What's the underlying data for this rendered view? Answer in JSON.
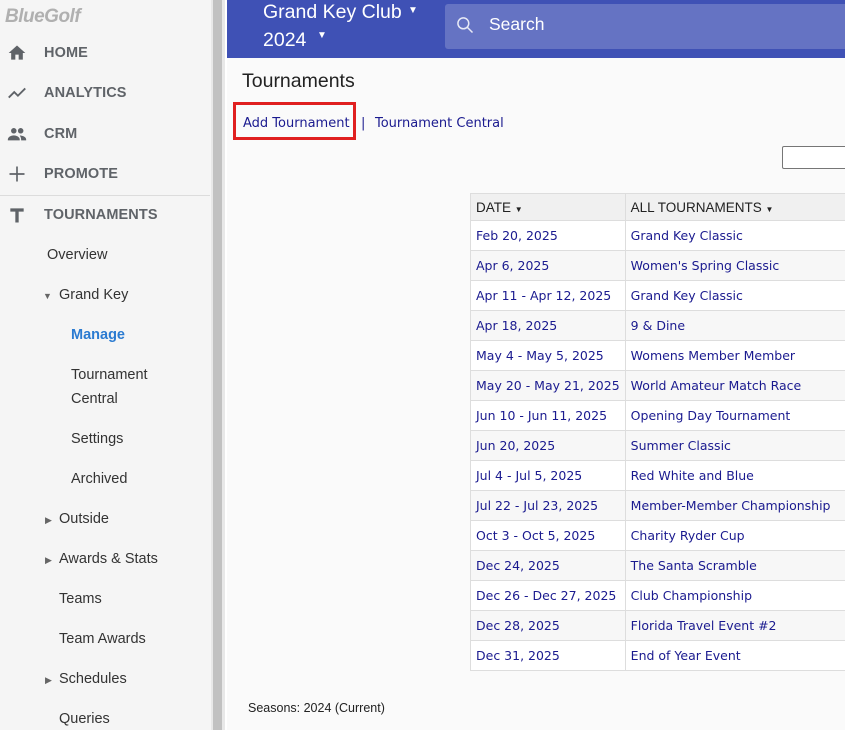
{
  "sidebar": {
    "logo": "BlueGolf",
    "main_items": [
      {
        "label": "HOME",
        "icon": "home-icon"
      },
      {
        "label": "ANALYTICS",
        "icon": "trending-up-icon"
      },
      {
        "label": "CRM",
        "icon": "people-icon"
      },
      {
        "label": "PROMOTE",
        "icon": "plus-icon"
      },
      {
        "label": "TOURNAMENTS",
        "icon": "tournament-t-icon"
      }
    ],
    "sub_items": {
      "overview": "Overview",
      "grand_key": "Grand Key",
      "manage": "Manage",
      "tournament_central_1": "Tournament",
      "tournament_central_2": "Central",
      "settings": "Settings",
      "archived": "Archived",
      "outside": "Outside",
      "awards_stats": "Awards & Stats",
      "teams": "Teams",
      "team_awards": "Team Awards",
      "schedules": "Schedules",
      "queries": "Queries"
    },
    "active_color": "#2b7bd1"
  },
  "header": {
    "club_name": "Grand Key Club",
    "year": "2024",
    "search_placeholder": "Search",
    "bg_color": "#3f51b5"
  },
  "main": {
    "page_title": "Tournaments",
    "add_tournament": "Add Tournament",
    "separator": "|",
    "tournament_central": "Tournament Central",
    "table": {
      "col_date": "DATE",
      "col_tournaments": "ALL TOURNAMENTS",
      "rows": [
        {
          "date": "Feb 20, 2025",
          "name": "Grand Key Classic"
        },
        {
          "date": "Apr 6, 2025",
          "name": "Women's Spring Classic"
        },
        {
          "date": "Apr 11 - Apr 12, 2025",
          "name": "Grand Key Classic"
        },
        {
          "date": "Apr 18, 2025",
          "name": "9 & Dine"
        },
        {
          "date": "May 4 - May 5, 2025",
          "name": "Womens Member Member"
        },
        {
          "date": "May 20 - May 21, 2025",
          "name": "World Amateur Match Race"
        },
        {
          "date": "Jun 10 - Jun 11, 2025",
          "name": "Opening Day Tournament"
        },
        {
          "date": "Jun 20, 2025",
          "name": "Summer Classic"
        },
        {
          "date": "Jul 4 - Jul 5, 2025",
          "name": "Red White and Blue"
        },
        {
          "date": "Jul 22 - Jul 23, 2025",
          "name": "Member-Member Championship"
        },
        {
          "date": "Oct 3 - Oct 5, 2025",
          "name": "Charity Ryder Cup"
        },
        {
          "date": "Dec 24, 2025",
          "name": "The Santa Scramble"
        },
        {
          "date": "Dec 26 - Dec 27, 2025",
          "name": "Club Championship"
        },
        {
          "date": "Dec 28, 2025",
          "name": "Florida Travel Event #2"
        },
        {
          "date": "Dec 31, 2025",
          "name": "End of Year Event"
        }
      ]
    },
    "seasons": "Seasons: 2024 (Current)",
    "highlight_color": "#e02020"
  }
}
